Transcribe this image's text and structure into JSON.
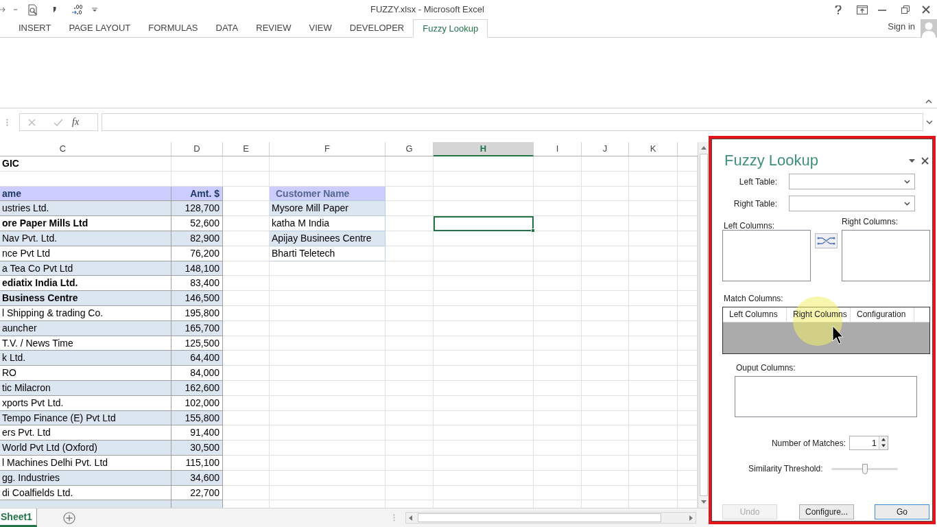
{
  "window": {
    "title": "FUZZY.xlsx - Microsoft Excel"
  },
  "ribbon": {
    "tabs": [
      {
        "label": "INSERT",
        "selected": false
      },
      {
        "label": "PAGE LAYOUT",
        "selected": false
      },
      {
        "label": "FORMULAS",
        "selected": false
      },
      {
        "label": "DATA",
        "selected": false
      },
      {
        "label": "REVIEW",
        "selected": false
      },
      {
        "label": "VIEW",
        "selected": false
      },
      {
        "label": "DEVELOPER",
        "selected": false
      },
      {
        "label": "Fuzzy Lookup",
        "selected": true
      }
    ],
    "account": "Sign in"
  },
  "formula_bar": {
    "function_button": "fx"
  },
  "sheet": {
    "columns": [
      {
        "label": "C",
        "selected": false
      },
      {
        "label": "D",
        "selected": false
      },
      {
        "label": "E",
        "selected": false
      },
      {
        "label": "F",
        "selected": false
      },
      {
        "label": "G",
        "selected": false
      },
      {
        "label": "H",
        "selected": true
      },
      {
        "label": "I",
        "selected": false
      },
      {
        "label": "J",
        "selected": false
      },
      {
        "label": "K",
        "selected": false
      }
    ],
    "title_cell": "GIC",
    "table": {
      "columns": [
        "ame",
        "Amt. $"
      ],
      "rows": [
        {
          "name": "ustries Ltd.",
          "amount": "128,700",
          "bold": false
        },
        {
          "name": "ore Paper Mills Ltd",
          "amount": "52,600",
          "bold": true
        },
        {
          "name": "Nav Pvt. Ltd.",
          "amount": "82,900",
          "bold": false
        },
        {
          "name": "nce Pvt Ltd",
          "amount": "76,200",
          "bold": false
        },
        {
          "name": "a Tea Co Pvt Ltd",
          "amount": "148,100",
          "bold": false
        },
        {
          "name": "ediatix India Ltd.",
          "amount": "83,400",
          "bold": true
        },
        {
          "name": "Business Centre",
          "amount": "146,500",
          "bold": true
        },
        {
          "name": "l Shipping & trading Co.",
          "amount": "195,800",
          "bold": false
        },
        {
          "name": "auncher",
          "amount": "165,700",
          "bold": false
        },
        {
          "name": "T.V. / News Time",
          "amount": "125,500",
          "bold": false
        },
        {
          "name": "k Ltd.",
          "amount": "64,400",
          "bold": false
        },
        {
          "name": "RO",
          "amount": "84,000",
          "bold": false
        },
        {
          "name": "tic Milacron",
          "amount": "162,600",
          "bold": false
        },
        {
          "name": "xports Pvt Ltd.",
          "amount": "102,000",
          "bold": false
        },
        {
          "name": "Tempo Finance (E) Pvt Ltd",
          "amount": "155,800",
          "bold": false
        },
        {
          "name": "ers Pvt. Ltd",
          "amount": "91,400",
          "bold": false
        },
        {
          "name": "World Pvt Ltd (Oxford)",
          "amount": "30,500",
          "bold": false
        },
        {
          "name": "l Machines Delhi Pvt. Ltd",
          "amount": "115,100",
          "bold": false
        },
        {
          "name": "gg. Industries",
          "amount": "34,600",
          "bold": false
        },
        {
          "name": "di Coalfields Ltd.",
          "amount": "22,700",
          "bold": false
        }
      ]
    },
    "lookup_table": {
      "column": "Customer Name",
      "rows": [
        "Mysore Mill Paper",
        "katha M India",
        "Apijay Businees Centre",
        "Bharti Teletech"
      ]
    }
  },
  "sheet_tabs": [
    {
      "label": "Sheet1",
      "selected": true
    }
  ],
  "panel": {
    "title": "Fuzzy Lookup",
    "left_table": {
      "label": "Left Table:"
    },
    "right_table": {
      "label": "Right Table:"
    },
    "left_columns": {
      "label": "Left Columns:"
    },
    "right_columns": {
      "label": "Right Columns:"
    },
    "match_columns": {
      "label": "Match Columns:",
      "headers": [
        "Left Columns",
        "Right Columns",
        "Configuration"
      ]
    },
    "output_columns": {
      "label": "Ouput Columns:"
    },
    "number_of_matches": {
      "label": "Number of Matches:",
      "value": "1"
    },
    "similarity_threshold": {
      "label": "Similarity Threshold:",
      "level": 0.5
    },
    "buttons": [
      {
        "label": "Undo",
        "disabled": true,
        "default": false
      },
      {
        "label": "Configure...",
        "disabled": false,
        "default": false
      },
      {
        "label": "Go",
        "disabled": false,
        "default": true
      }
    ]
  }
}
